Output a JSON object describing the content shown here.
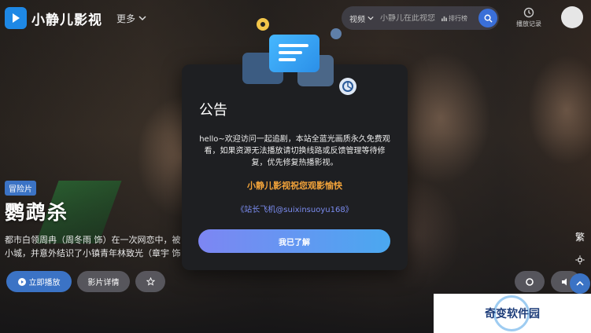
{
  "brand": {
    "name": "小静儿影视"
  },
  "nav": {
    "more_label": "更多"
  },
  "search": {
    "type_label": "视频",
    "placeholder": "小静儿在此视您",
    "rank_label": "排行榜"
  },
  "header": {
    "history_label": "播放记录"
  },
  "hero": {
    "tag": "冒险片",
    "title": "鹦鹉杀",
    "desc_line1": "都市白领周冉（周冬雨 饰）在一次网恋中，被",
    "desc_line2": "小城，并意外结识了小镇青年林致光（章宇 饰",
    "play_label": "立即播放",
    "detail_label": "影片详情"
  },
  "side": {
    "traditional_label": "繁"
  },
  "modal": {
    "title": "公告",
    "body": "hello~欢迎访问一起追剧，本站全蓝光画质永久免费观看，如果资源无法播放请切换线路或反馈管理等待修复，优先修复热播影视。",
    "highlight": "小静儿影视祝您观影愉快",
    "contact": "《站长飞机@suixinsuoyu168》",
    "confirm_label": "我已了解"
  },
  "watermark": {
    "text": "奇变软件园"
  },
  "colors": {
    "accent": "#3b73c5",
    "highlight": "#f2a33a",
    "contact": "#7b8cf0",
    "modal_bg": "#1e1f22"
  }
}
